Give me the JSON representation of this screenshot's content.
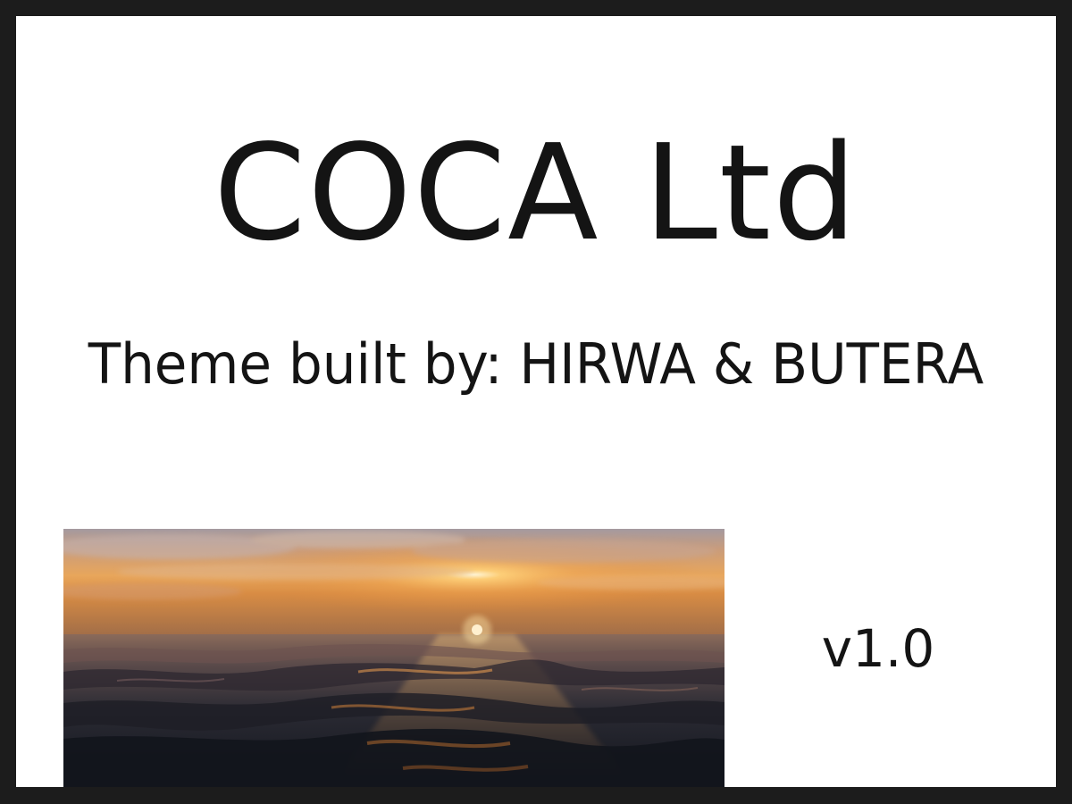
{
  "slide": {
    "title": "COCA Ltd",
    "subtitle": "Theme built by: HIRWA & BUTERA",
    "version": "v1.0",
    "image_icon": "sunset-over-ocean-photo"
  },
  "colors": {
    "frame": "#1c1c1c",
    "background": "#ffffff",
    "text": "#141414",
    "sky_top": "#b79a88",
    "sky_glow": "#f2b25a",
    "sun": "#fff7e0",
    "water_dark": "#151a22"
  }
}
